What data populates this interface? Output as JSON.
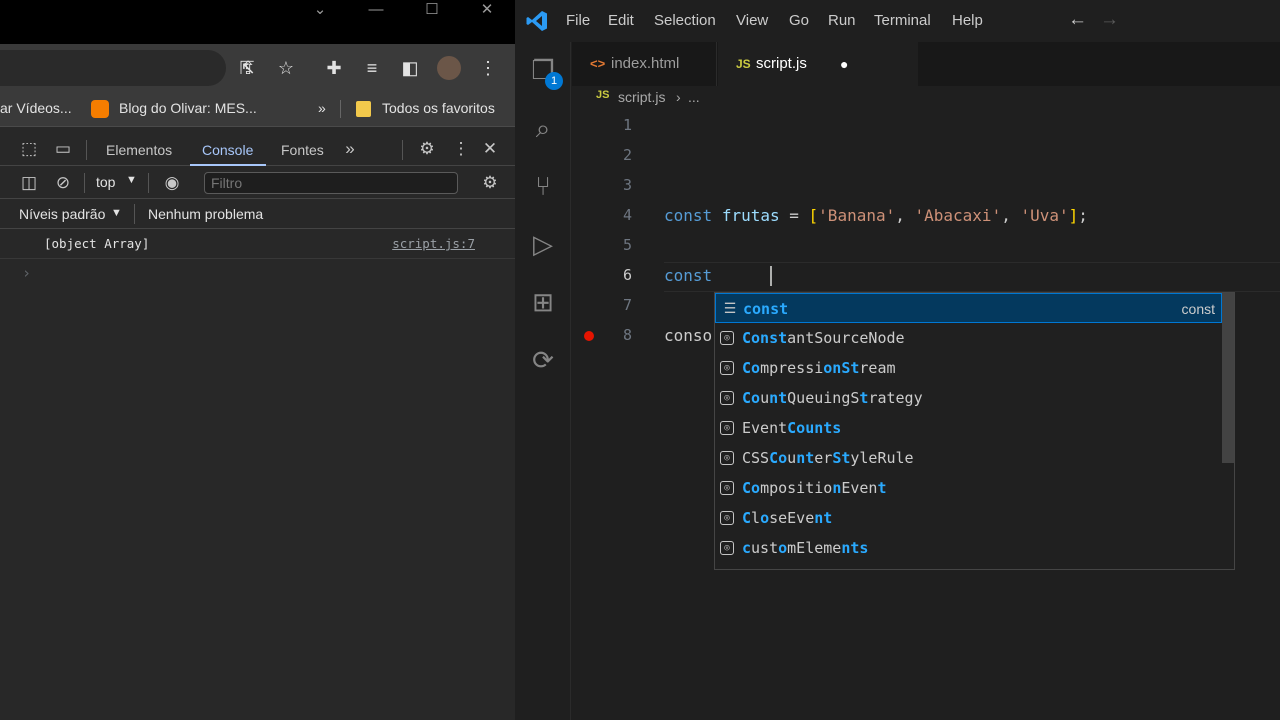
{
  "chrome": {
    "bookmarks": [
      {
        "label": "ar Vídeos..."
      },
      {
        "label": "Blog do Olivar: MES..."
      },
      {
        "label": "»"
      },
      {
        "label": "Todos os favoritos"
      }
    ]
  },
  "devtools": {
    "tabs": [
      "Elementos",
      "Console",
      "Fontes"
    ],
    "context": "top",
    "filter_placeholder": "Filtro",
    "levels": "Níveis padrão",
    "issues": "Nenhum problema",
    "console_lines": [
      {
        "text": "[object Array]",
        "source": "script.js:7"
      }
    ],
    "prompt": "›"
  },
  "vscode": {
    "menu": [
      "File",
      "Edit",
      "Selection",
      "View",
      "Go",
      "Run",
      "Terminal",
      "Help"
    ],
    "explorer_badge": "1",
    "tabs": [
      {
        "label": "index.html",
        "icon": "html-icon"
      },
      {
        "label": "script.js",
        "icon": "js-icon",
        "dirty": true
      }
    ],
    "breadcrumb": {
      "file": "script.js",
      "rest": "..."
    },
    "line_numbers": [
      "1",
      "2",
      "3",
      "4",
      "5",
      "6",
      "7",
      "8"
    ],
    "code": {
      "line4": {
        "kw": "const",
        "name": "frutas",
        "eq": "=",
        "items": [
          "'Banana'",
          "'Abacaxi'",
          "'Uva'"
        ]
      },
      "line6": "const",
      "line8": "conso"
    },
    "suggestions": [
      {
        "pre": "",
        "hl": "const",
        "post": "",
        "detail": "const",
        "kind": "keyword"
      },
      {
        "pre": "",
        "hl": "Const",
        "post": "antSourceNode",
        "kind": "class"
      },
      {
        "pre": "",
        "hl": "Co",
        "post": "mpressi",
        "hl2": "onSt",
        "post2": "ream",
        "kind": "class"
      },
      {
        "pre": "",
        "hl": "Co",
        "post": "u",
        "hl2": "nt",
        "post2": "QueuingS",
        "hl3": "t",
        "post3": "rategy",
        "kind": "class"
      },
      {
        "pre": "Event",
        "hl": "Counts",
        "post": "",
        "kind": "class"
      },
      {
        "pre": "CSS",
        "hl": "Co",
        "post": "u",
        "hl2": "nt",
        "post2": "er",
        "hl3": "St",
        "post3": "yleRule",
        "kind": "class"
      },
      {
        "pre": "",
        "hl": "Co",
        "post": "mpositio",
        "hl2": "n",
        "post2": "Even",
        "hl3": "t",
        "post3": "",
        "kind": "class"
      },
      {
        "pre": "",
        "hl": "C",
        "post": "l",
        "hl2": "o",
        "post2": "seEve",
        "hl3": "nt",
        "post3": "",
        "kind": "class"
      },
      {
        "pre": "",
        "hl": "c",
        "post": "ust",
        "hl2": "o",
        "post2": "mEleme",
        "hl3": "nts",
        "post3": "",
        "kind": "class"
      }
    ]
  }
}
